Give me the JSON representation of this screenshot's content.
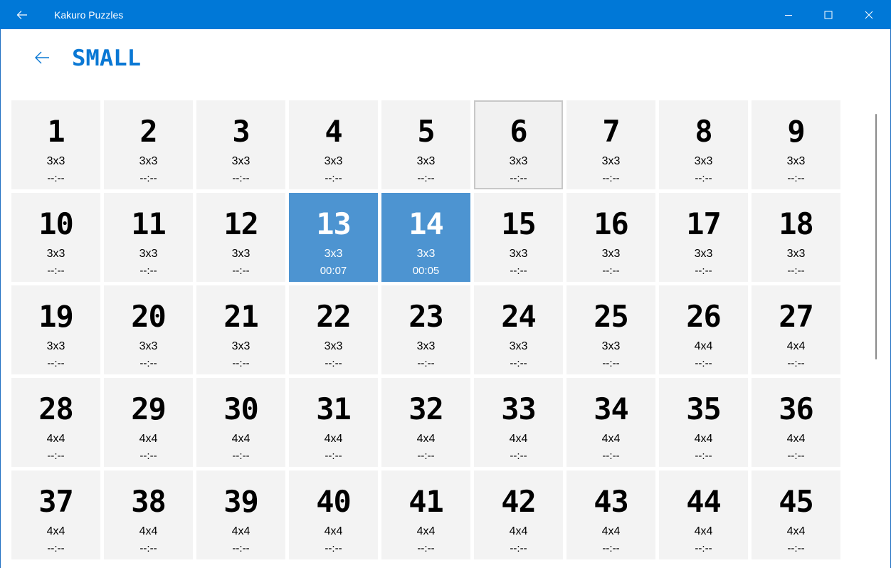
{
  "window": {
    "title": "Kakuro Puzzles"
  },
  "header": {
    "title": "SMALL"
  },
  "colors": {
    "accent": "#0078d7",
    "tile_background": "#f3f3f3",
    "tile_selected": "#4d94d1"
  },
  "icons": {
    "back": "arrow-left-icon",
    "minimize": "minimize-icon",
    "maximize": "maximize-icon",
    "close": "close-icon"
  },
  "puzzles": [
    {
      "number": "1",
      "size": "3x3",
      "time": "--:--",
      "state": "normal"
    },
    {
      "number": "2",
      "size": "3x3",
      "time": "--:--",
      "state": "normal"
    },
    {
      "number": "3",
      "size": "3x3",
      "time": "--:--",
      "state": "normal"
    },
    {
      "number": "4",
      "size": "3x3",
      "time": "--:--",
      "state": "normal"
    },
    {
      "number": "5",
      "size": "3x3",
      "time": "--:--",
      "state": "normal"
    },
    {
      "number": "6",
      "size": "3x3",
      "time": "--:--",
      "state": "focused"
    },
    {
      "number": "7",
      "size": "3x3",
      "time": "--:--",
      "state": "normal"
    },
    {
      "number": "8",
      "size": "3x3",
      "time": "--:--",
      "state": "normal"
    },
    {
      "number": "9",
      "size": "3x3",
      "time": "--:--",
      "state": "normal"
    },
    {
      "number": "10",
      "size": "3x3",
      "time": "--:--",
      "state": "normal"
    },
    {
      "number": "11",
      "size": "3x3",
      "time": "--:--",
      "state": "normal"
    },
    {
      "number": "12",
      "size": "3x3",
      "time": "--:--",
      "state": "normal"
    },
    {
      "number": "13",
      "size": "3x3",
      "time": "00:07",
      "state": "selected"
    },
    {
      "number": "14",
      "size": "3x3",
      "time": "00:05",
      "state": "selected"
    },
    {
      "number": "15",
      "size": "3x3",
      "time": "--:--",
      "state": "normal"
    },
    {
      "number": "16",
      "size": "3x3",
      "time": "--:--",
      "state": "normal"
    },
    {
      "number": "17",
      "size": "3x3",
      "time": "--:--",
      "state": "normal"
    },
    {
      "number": "18",
      "size": "3x3",
      "time": "--:--",
      "state": "normal"
    },
    {
      "number": "19",
      "size": "3x3",
      "time": "--:--",
      "state": "normal"
    },
    {
      "number": "20",
      "size": "3x3",
      "time": "--:--",
      "state": "normal"
    },
    {
      "number": "21",
      "size": "3x3",
      "time": "--:--",
      "state": "normal"
    },
    {
      "number": "22",
      "size": "3x3",
      "time": "--:--",
      "state": "normal"
    },
    {
      "number": "23",
      "size": "3x3",
      "time": "--:--",
      "state": "normal"
    },
    {
      "number": "24",
      "size": "3x3",
      "time": "--:--",
      "state": "normal"
    },
    {
      "number": "25",
      "size": "3x3",
      "time": "--:--",
      "state": "normal"
    },
    {
      "number": "26",
      "size": "4x4",
      "time": "--:--",
      "state": "normal"
    },
    {
      "number": "27",
      "size": "4x4",
      "time": "--:--",
      "state": "normal"
    },
    {
      "number": "28",
      "size": "4x4",
      "time": "--:--",
      "state": "normal"
    },
    {
      "number": "29",
      "size": "4x4",
      "time": "--:--",
      "state": "normal"
    },
    {
      "number": "30",
      "size": "4x4",
      "time": "--:--",
      "state": "normal"
    },
    {
      "number": "31",
      "size": "4x4",
      "time": "--:--",
      "state": "normal"
    },
    {
      "number": "32",
      "size": "4x4",
      "time": "--:--",
      "state": "normal"
    },
    {
      "number": "33",
      "size": "4x4",
      "time": "--:--",
      "state": "normal"
    },
    {
      "number": "34",
      "size": "4x4",
      "time": "--:--",
      "state": "normal"
    },
    {
      "number": "35",
      "size": "4x4",
      "time": "--:--",
      "state": "normal"
    },
    {
      "number": "36",
      "size": "4x4",
      "time": "--:--",
      "state": "normal"
    },
    {
      "number": "37",
      "size": "4x4",
      "time": "--:--",
      "state": "normal"
    },
    {
      "number": "38",
      "size": "4x4",
      "time": "--:--",
      "state": "normal"
    },
    {
      "number": "39",
      "size": "4x4",
      "time": "--:--",
      "state": "normal"
    },
    {
      "number": "40",
      "size": "4x4",
      "time": "--:--",
      "state": "normal"
    },
    {
      "number": "41",
      "size": "4x4",
      "time": "--:--",
      "state": "normal"
    },
    {
      "number": "42",
      "size": "4x4",
      "time": "--:--",
      "state": "normal"
    },
    {
      "number": "43",
      "size": "4x4",
      "time": "--:--",
      "state": "normal"
    },
    {
      "number": "44",
      "size": "4x4",
      "time": "--:--",
      "state": "normal"
    },
    {
      "number": "45",
      "size": "4x4",
      "time": "--:--",
      "state": "normal"
    }
  ]
}
